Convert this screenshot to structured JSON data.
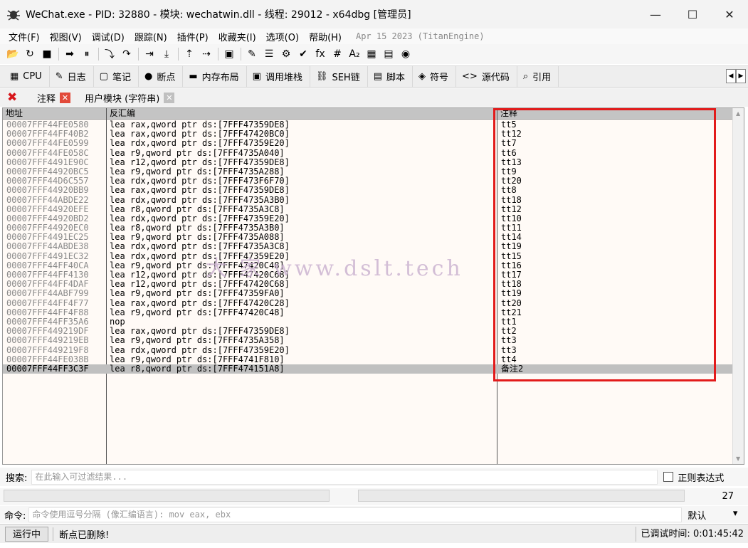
{
  "window": {
    "title": "WeChat.exe - PID: 32880 - 模块: wechatwin.dll - 线程: 29012 - x64dbg [管理员]",
    "minimize": "—",
    "maximize": "☐",
    "close": "✕"
  },
  "menu": {
    "items": [
      "文件(F)",
      "视图(V)",
      "调试(D)",
      "跟踪(N)",
      "插件(P)",
      "收藏夹(I)",
      "选项(O)",
      "帮助(H)"
    ],
    "info": "Apr 15 2023 (TitanEngine)"
  },
  "toolbar": {
    "icons": [
      {
        "name": "open-icon",
        "glyph": "📂"
      },
      {
        "name": "restart-icon",
        "glyph": "↻"
      },
      {
        "name": "stop-icon",
        "glyph": "■"
      },
      {
        "name": "run-icon",
        "glyph": "➡"
      },
      {
        "name": "pause-icon",
        "glyph": "⏸"
      },
      {
        "name": "step-into-icon",
        "glyph": "⤵"
      },
      {
        "name": "step-over-icon",
        "glyph": "↷"
      },
      {
        "name": "trace-into-icon",
        "glyph": "⇥"
      },
      {
        "name": "trace-over-icon",
        "glyph": "⤓"
      },
      {
        "name": "execute-till-return-icon",
        "glyph": "⇡"
      },
      {
        "name": "run-to-user-code-icon",
        "glyph": "⇢"
      },
      {
        "name": "scylla-icon",
        "glyph": "▣"
      },
      {
        "name": "patch-icon",
        "glyph": "✎"
      },
      {
        "name": "comments-icon",
        "glyph": "☰"
      },
      {
        "name": "labels-icon",
        "glyph": "⚙"
      },
      {
        "name": "bookmarks-icon",
        "glyph": "✔"
      },
      {
        "name": "functions-icon",
        "glyph": "fx"
      },
      {
        "name": "variables-icon",
        "glyph": "#"
      },
      {
        "name": "font-icon",
        "glyph": "A₂"
      },
      {
        "name": "calculator-icon",
        "glyph": "▦"
      },
      {
        "name": "notes-icon",
        "glyph": "▤"
      },
      {
        "name": "globe-icon",
        "glyph": "◉"
      }
    ]
  },
  "tabs": [
    {
      "label": "CPU",
      "icon": "cpu-icon",
      "glyph": "▦"
    },
    {
      "label": "日志",
      "icon": "log-icon",
      "glyph": "✎"
    },
    {
      "label": "笔记",
      "icon": "notes-tab-icon",
      "glyph": "▢"
    },
    {
      "label": "断点",
      "icon": "breakpoint-icon",
      "glyph": "●"
    },
    {
      "label": "内存布局",
      "icon": "memory-map-icon",
      "glyph": "▬"
    },
    {
      "label": "调用堆栈",
      "icon": "call-stack-icon",
      "glyph": "▣"
    },
    {
      "label": "SEH链",
      "icon": "seh-icon",
      "glyph": "⛓"
    },
    {
      "label": "脚本",
      "icon": "script-icon",
      "glyph": "▤"
    },
    {
      "label": "符号",
      "icon": "symbols-icon",
      "glyph": "◈"
    },
    {
      "label": "源代码",
      "icon": "source-icon",
      "glyph": "<>"
    },
    {
      "label": "引用",
      "icon": "references-icon",
      "glyph": "⌕"
    }
  ],
  "subtabs": {
    "active": "注释",
    "other": "用户模块 (字符串)"
  },
  "grid": {
    "headers": {
      "address": "地址",
      "disasm": "反汇编",
      "comment": "注释"
    },
    "rows": [
      {
        "addr": "00007FFF44FE0580",
        "asm": "lea rax,qword ptr ds:[7FFF47359DE8]",
        "comment": "tt5"
      },
      {
        "addr": "00007FFF44FF40B2",
        "asm": "lea rax,qword ptr ds:[7FFF47420BC0]",
        "comment": "tt12"
      },
      {
        "addr": "00007FFF44FE0599",
        "asm": "lea rdx,qword ptr ds:[7FFF47359E20]",
        "comment": "tt7"
      },
      {
        "addr": "00007FFF44FE058C",
        "asm": "lea r9,qword ptr ds:[7FFF4735A040]",
        "comment": "tt6"
      },
      {
        "addr": "00007FFF4491E90C",
        "asm": "lea r12,qword ptr ds:[7FFF47359DE8]",
        "comment": "tt13"
      },
      {
        "addr": "00007FFF44920BC5",
        "asm": "lea r9,qword ptr ds:[7FFF4735A288]",
        "comment": "tt9"
      },
      {
        "addr": "00007FFF44D6C557",
        "asm": "lea rdx,qword ptr ds:[7FFF473F6F70]",
        "comment": "tt20"
      },
      {
        "addr": "00007FFF44920BB9",
        "asm": "lea rax,qword ptr ds:[7FFF47359DE8]",
        "comment": "tt8"
      },
      {
        "addr": "00007FFF44ABDE22",
        "asm": "lea rdx,qword ptr ds:[7FFF4735A3B0]",
        "comment": "tt18"
      },
      {
        "addr": "00007FFF44920EFE",
        "asm": "lea r8,qword ptr ds:[7FFF4735A3C8]",
        "comment": "tt12"
      },
      {
        "addr": "00007FFF44920BD2",
        "asm": "lea rdx,qword ptr ds:[7FFF47359E20]",
        "comment": "tt10"
      },
      {
        "addr": "00007FFF44920EC0",
        "asm": "lea r8,qword ptr ds:[7FFF4735A3B0]",
        "comment": "tt11"
      },
      {
        "addr": "00007FFF4491EC25",
        "asm": "lea r9,qword ptr ds:[7FFF4735A088]",
        "comment": "tt14"
      },
      {
        "addr": "00007FFF44ABDE38",
        "asm": "lea rdx,qword ptr ds:[7FFF4735A3C8]",
        "comment": "tt19"
      },
      {
        "addr": "00007FFF4491EC32",
        "asm": "lea rdx,qword ptr ds:[7FFF47359E20]",
        "comment": "tt15"
      },
      {
        "addr": "00007FFF44FF40CA",
        "asm": "lea r9,qword ptr ds:[7FFF47420C48]",
        "comment": "tt16"
      },
      {
        "addr": "00007FFF44FF4130",
        "asm": "lea r12,qword ptr ds:[7FFF47420C68]",
        "comment": "tt17"
      },
      {
        "addr": "00007FFF44FF4DAF",
        "asm": "lea r12,qword ptr ds:[7FFF47420C68]",
        "comment": "tt18"
      },
      {
        "addr": "00007FFF44ABF799",
        "asm": "lea r9,qword ptr ds:[7FFF47359FA0]",
        "comment": "tt19"
      },
      {
        "addr": "00007FFF44FF4F77",
        "asm": "lea rax,qword ptr ds:[7FFF47420C28]",
        "comment": "tt20"
      },
      {
        "addr": "00007FFF44FF4F88",
        "asm": "lea r9,qword ptr ds:[7FFF47420C48]",
        "comment": "tt21"
      },
      {
        "addr": "00007FFF44FF35A6",
        "asm": "nop",
        "comment": "tt1"
      },
      {
        "addr": "00007FFF449219DF",
        "asm": "lea rax,qword ptr ds:[7FFF47359DE8]",
        "comment": "tt2"
      },
      {
        "addr": "00007FFF449219EB",
        "asm": "lea r9,qword ptr ds:[7FFF4735A358]",
        "comment": "tt3"
      },
      {
        "addr": "00007FFF449219F8",
        "asm": "lea rdx,qword ptr ds:[7FFF47359E20]",
        "comment": "tt3"
      },
      {
        "addr": "00007FFF44FE038B",
        "asm": "lea r9,qword ptr ds:[7FFF4741F810]",
        "comment": "tt4"
      },
      {
        "addr": "00007FFF44FF3C3F",
        "asm": "lea r8,qword ptr ds:[7FFF474151A8]",
        "comment": "备注2",
        "selected": true
      }
    ],
    "watermark": "大  家  www.dslt.tech"
  },
  "search": {
    "label": "搜索:",
    "placeholder": "在此输入可过滤结果...",
    "regex_label": "正则表达式"
  },
  "progress": {
    "count": "27"
  },
  "command": {
    "label": "命令:",
    "placeholder": "命令使用逗号分隔 (像汇编语言): mov eax, ebx",
    "mode": "默认",
    "mode_arrow": "▾"
  },
  "status": {
    "state": "运行中",
    "message": "断点已删除!",
    "time_label": "已调试时间:",
    "time_value": "0:01:45:42"
  },
  "colors": {
    "highlight_border": "#e21b1b",
    "selected_row": "#c0c0c0",
    "grid_bg": "#fffaf6",
    "address_text": "#8a8a8a"
  }
}
